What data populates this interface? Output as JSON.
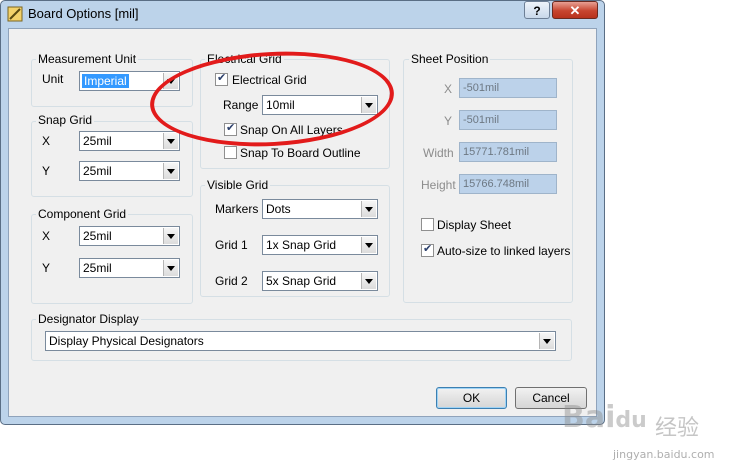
{
  "window": {
    "title": "Board Options [mil]",
    "help_glyph": "?",
    "close_glyph": "✕"
  },
  "measurement_unit": {
    "legend": "Measurement Unit",
    "unit_label": "Unit",
    "unit_value": "Imperial"
  },
  "snap_grid": {
    "legend": "Snap Grid",
    "x_label": "X",
    "x_value": "25mil",
    "y_label": "Y",
    "y_value": "25mil"
  },
  "component_grid": {
    "legend": "Component Grid",
    "x_label": "X",
    "x_value": "25mil",
    "y_label": "Y",
    "y_value": "25mil"
  },
  "electrical_grid": {
    "legend": "Electrical Grid",
    "checkbox_label": "Electrical Grid",
    "checked": true,
    "range_label": "Range",
    "range_value": "10mil",
    "snap_all_label": "Snap On All Layers",
    "snap_all_checked": true,
    "snap_outline_label": "Snap To Board Outline",
    "snap_outline_checked": false
  },
  "visible_grid": {
    "legend": "Visible Grid",
    "markers_label": "Markers",
    "markers_value": "Dots",
    "grid1_label": "Grid 1",
    "grid1_value": "1x Snap Grid",
    "grid2_label": "Grid 2",
    "grid2_value": "5x Snap Grid"
  },
  "sheet_position": {
    "legend": "Sheet Position",
    "x_label": "X",
    "x_value": "-501mil",
    "y_label": "Y",
    "y_value": "-501mil",
    "width_label": "Width",
    "width_value": "15771.781mil",
    "height_label": "Height",
    "height_value": "15766.748mil",
    "display_sheet_label": "Display Sheet",
    "display_sheet_checked": false,
    "autosize_label": "Auto-size to linked layers",
    "autosize_checked": true
  },
  "designator_display": {
    "legend": "Designator Display",
    "value": "Display Physical Designators"
  },
  "buttons": {
    "ok": "OK",
    "cancel": "Cancel"
  },
  "annotation": {
    "color": "#e21b1b"
  },
  "watermark": {
    "logo_text": "Bai",
    "logo_paw": "du",
    "cn_text": "经验",
    "url": "jingyan.baidu.com"
  }
}
